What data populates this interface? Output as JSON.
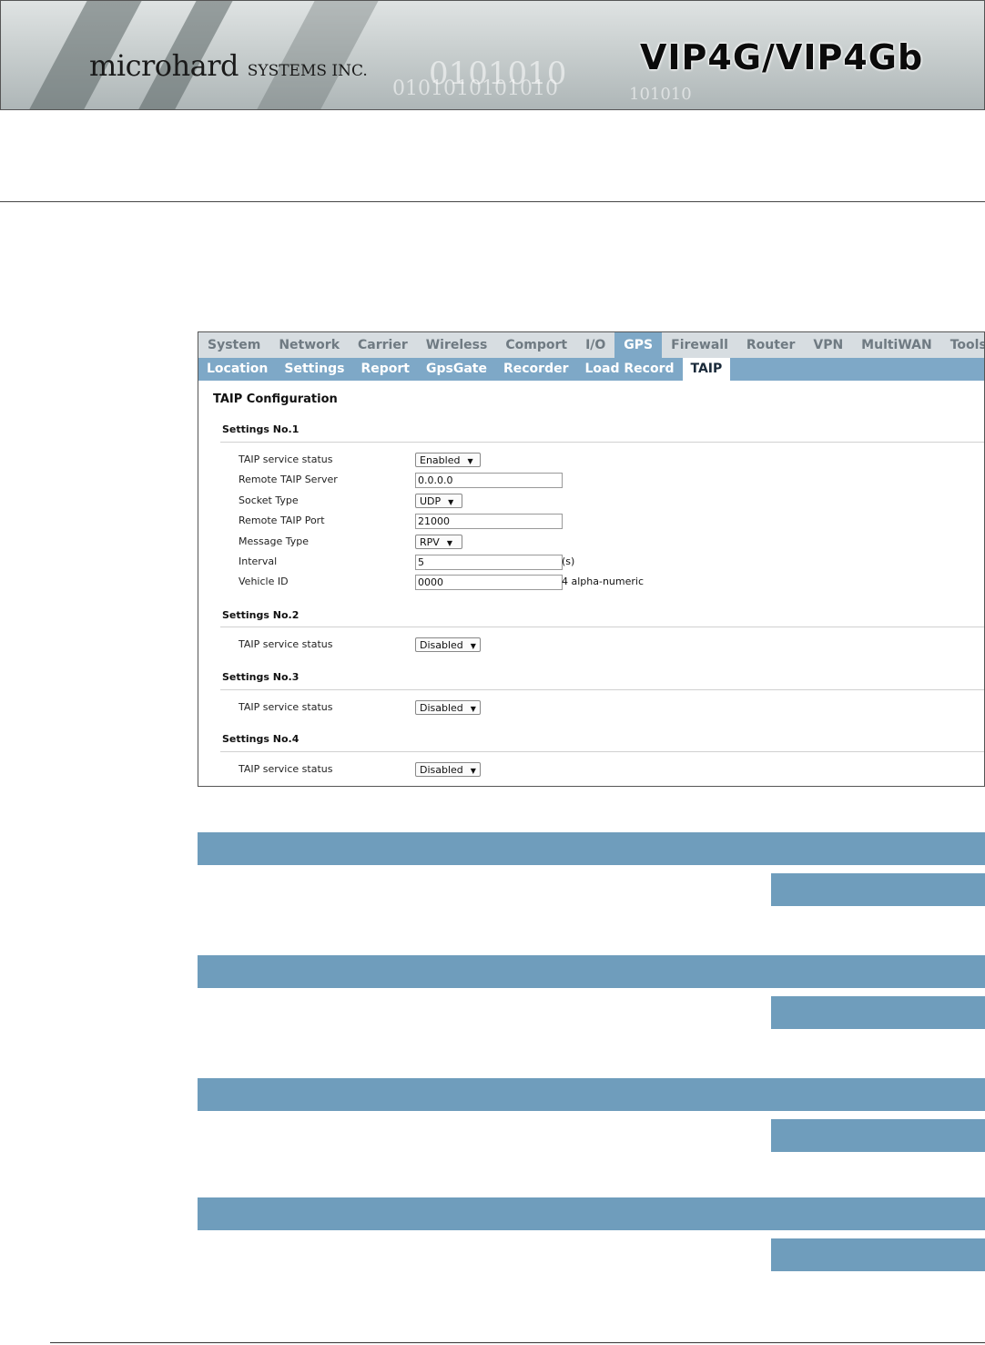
{
  "header": {
    "logo_main": "microhard",
    "logo_sub": "SYSTEMS INC.",
    "product_title": "VIP4G/VIP4Gb",
    "binary_line_1": "0101010",
    "binary_line_2": "0101010101010",
    "binary_line_3": "101010"
  },
  "menu": {
    "top_items": [
      "System",
      "Network",
      "Carrier",
      "Wireless",
      "Comport",
      "I/O",
      "GPS",
      "Firewall",
      "Router",
      "VPN",
      "MultiWAN",
      "Tools"
    ],
    "top_active": "GPS",
    "sub_items": [
      "Location",
      "Settings",
      "Report",
      "GpsGate",
      "Recorder",
      "Load Record",
      "TAIP"
    ],
    "sub_active": "TAIP"
  },
  "config": {
    "title": "TAIP Configuration",
    "s1": {
      "title": "Settings No.1",
      "status_label": "TAIP service status",
      "status_value": "Enabled",
      "server_label": "Remote TAIP Server",
      "server_value": "0.0.0.0",
      "socket_label": "Socket Type",
      "socket_value": "UDP",
      "port_label": "Remote TAIP Port",
      "port_value": "21000",
      "msg_label": "Message Type",
      "msg_value": "RPV",
      "interval_label": "Interval",
      "interval_value": "5",
      "interval_suffix": "(s)",
      "vehicle_label": "Vehicle ID",
      "vehicle_value": "0000",
      "vehicle_suffix": "4 alpha-numeric"
    },
    "s2": {
      "title": "Settings No.2",
      "status_label": "TAIP service status",
      "status_value": "Disabled"
    },
    "s3": {
      "title": "Settings No.3",
      "status_label": "TAIP service status",
      "status_value": "Disabled"
    },
    "s4": {
      "title": "Settings No.4",
      "status_label": "TAIP service status",
      "status_value": "Disabled"
    }
  },
  "colors": {
    "menu_active": "#7ea8c7",
    "bar_blue": "#6f9dbc"
  }
}
